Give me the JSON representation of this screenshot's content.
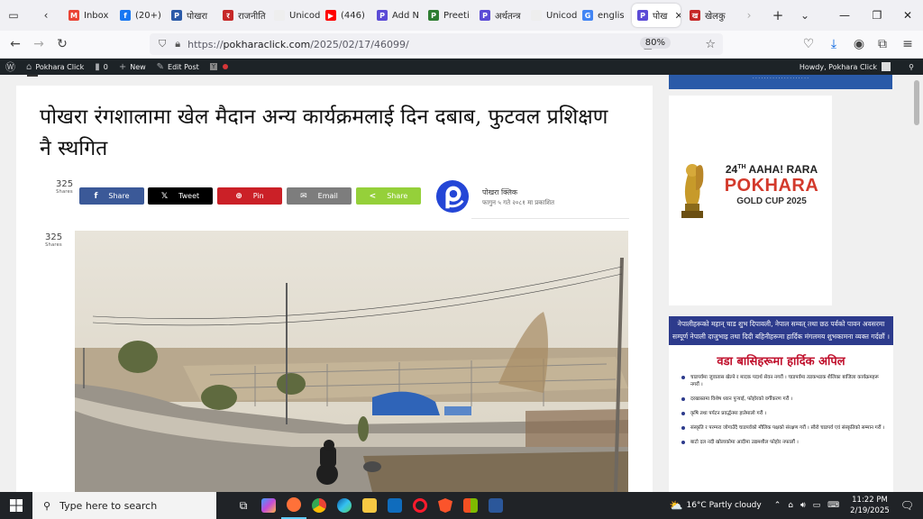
{
  "browser": {
    "tabs": [
      {
        "label": "Inbox",
        "fav_color": "#ea4335",
        "fav_glyph": "M"
      },
      {
        "label": "(20+)",
        "fav_color": "#1877f2",
        "fav_glyph": "f"
      },
      {
        "label": "पोखरा",
        "fav_color": "#2b5aa8",
        "fav_glyph": "P"
      },
      {
        "label": "राजनीति",
        "fav_color": "#c62828",
        "fav_glyph": "र"
      },
      {
        "label": "Unicode t",
        "fav_color": "#eeeeee",
        "fav_glyph": ""
      },
      {
        "label": "(446)",
        "fav_color": "#ff0000",
        "fav_glyph": "▶"
      },
      {
        "label": "Add N",
        "fav_color": "#5b4bd6",
        "fav_glyph": "P"
      },
      {
        "label": "Preeti",
        "fav_color": "#2e7d32",
        "fav_glyph": "P"
      },
      {
        "label": "अर्थतन्त्र",
        "fav_color": "#5b4bd6",
        "fav_glyph": "P"
      },
      {
        "label": "Unicode t",
        "fav_color": "#eeeeee",
        "fav_glyph": ""
      },
      {
        "label": "englis",
        "fav_color": "#4285f4",
        "fav_glyph": "G"
      },
      {
        "label": "पोख",
        "fav_color": "#5b4bd6",
        "fav_glyph": "P"
      },
      {
        "label": "खेलकु",
        "fav_color": "#c62828",
        "fav_glyph": "ख"
      }
    ],
    "active_tab_index": 11,
    "url_prefix": "https://",
    "url_host": "pokharaclick.com",
    "url_path": "/2025/02/17/46099/",
    "zoom": "80%"
  },
  "wp_admin": {
    "site_name": "Pokhara Click",
    "comments": "0",
    "new_label": "New",
    "edit_label": "Edit Post",
    "howdy": "Howdy, Pokhara Click"
  },
  "article": {
    "headline": "पोखरा रंगशालामा खेल मैदान अन्य कार्यक्रमलाई दिन दबाब, फुटवल प्रशिक्षण नै स्थगित",
    "share_count": "325",
    "share_count_label": "Shares",
    "share_buttons": [
      {
        "label": "Share",
        "icon": "f",
        "color": "#3b5998"
      },
      {
        "label": "Tweet",
        "icon": "𝕏",
        "color": "#000000"
      },
      {
        "label": "Pin",
        "icon": "⊕",
        "color": "#cb2027"
      },
      {
        "label": "Email",
        "icon": "✉",
        "color": "#7d7d7d"
      },
      {
        "label": "Share",
        "icon": "<",
        "color": "#95d03a"
      }
    ],
    "author_name": "पोखरा क्लिक",
    "published": "फागुन ५ गते २०८१ मा प्रकाशित",
    "side_share_count": "325",
    "side_share_label": "Shares"
  },
  "sidebar": {
    "ad1": {
      "line1": "24",
      "line1_sup": "TH",
      "line1_rest": "AAHA! RARA",
      "line2": "POKHARA",
      "line3": "GOLD CUP 2025"
    },
    "ad2": {
      "banner": "नेपालीहरूको महान् चाड शुभ दिपावली, नेपाल सम्वत् तथा छठ पर्वको पावन अवसरमा सम्पूर्ण नेपाली दाजुभाइ तथा दिदी बहिनीहरूमा हार्दिक मंगलमय शुभकामना व्यक्त गर्दछौं ।",
      "title": "वडा बासिहरूमा हार्दिक अपिल",
      "bullets": [
        "चाडपर्वमा जुवातास खेल्ने र मादक पदार्थ सेवन नगरौं । चाडपर्वमा तडकभडक शैलिका बाजिला कार्यक्रमहरू नगरौं ।",
        "दरखास्तमा विशेष ध्यान पुऱ्याई, फोहोरको वर्गीकरण गरौं ।",
        "कृषि तथा पर्यटन प्रवर्द्धनमा हातेमालो गरौं ।",
        "संस्कृति र परम्परा जोगाउँदै चाडपर्वको मौलिक पक्षको संरक्षण गरौं । स्वैरो चाडपर्व एवं संस्कृतिको सम्मान गरौं ।",
        "बाटो दल नदी खोलाकोमा आदीमा उद्यमशील फोहोर नफालौं ।"
      ]
    }
  },
  "taskbar": {
    "search_placeholder": "Type here to search",
    "weather": "16°C  Partly cloudy",
    "time": "11:22 PM",
    "date": "2/19/2025"
  }
}
